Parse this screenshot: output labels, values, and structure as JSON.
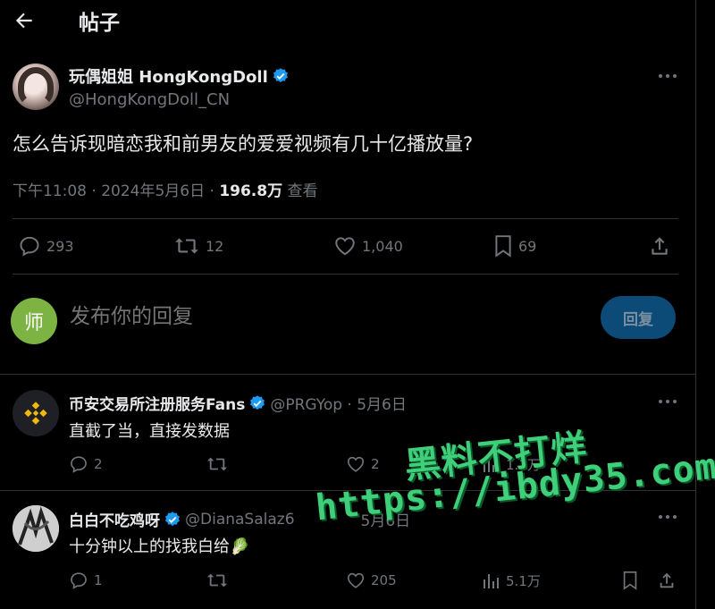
{
  "header": {
    "title": "帖子"
  },
  "post": {
    "display_name": "玩偶姐姐 HongKongDoll",
    "handle": "@HongKongDoll_CN",
    "text": "怎么告诉现暗恋我和前男友的爱爱视频有几十亿播放量?",
    "time": "下午11:08 · 2024年5月6日 · ",
    "views": "196.8万",
    "views_label": " 查看",
    "stats": {
      "replies": "293",
      "reposts": "12",
      "likes": "1,040",
      "bookmarks": "69"
    }
  },
  "composer": {
    "avatar_char": "师",
    "placeholder": "发布你的回复",
    "button_label": "回复"
  },
  "comments": [
    {
      "display_name": "币安交易所注册服务Fans",
      "handle": "@PRGYop · 5月6日",
      "text": "直截了当，直接发数据",
      "replies": "2",
      "likes": "2",
      "views": "1.1万"
    },
    {
      "display_name": "白白不吃鸡呀",
      "handle": "@DianaSalaz6",
      "date": "5月6日",
      "text": "十分钟以上的找我白给",
      "emoji": "🥬",
      "replies": "1",
      "likes": "205",
      "views": "5.1万"
    }
  ],
  "watermark": {
    "line1": "黑料不打烊",
    "line2": "https://ibdy35.com"
  },
  "colors": {
    "background": "#000000",
    "text": "#e7e9ea",
    "muted": "#71767b",
    "verified": "#1d9bf0",
    "reply_button": "#0c4a77",
    "watermark": "#3fcf7a"
  }
}
